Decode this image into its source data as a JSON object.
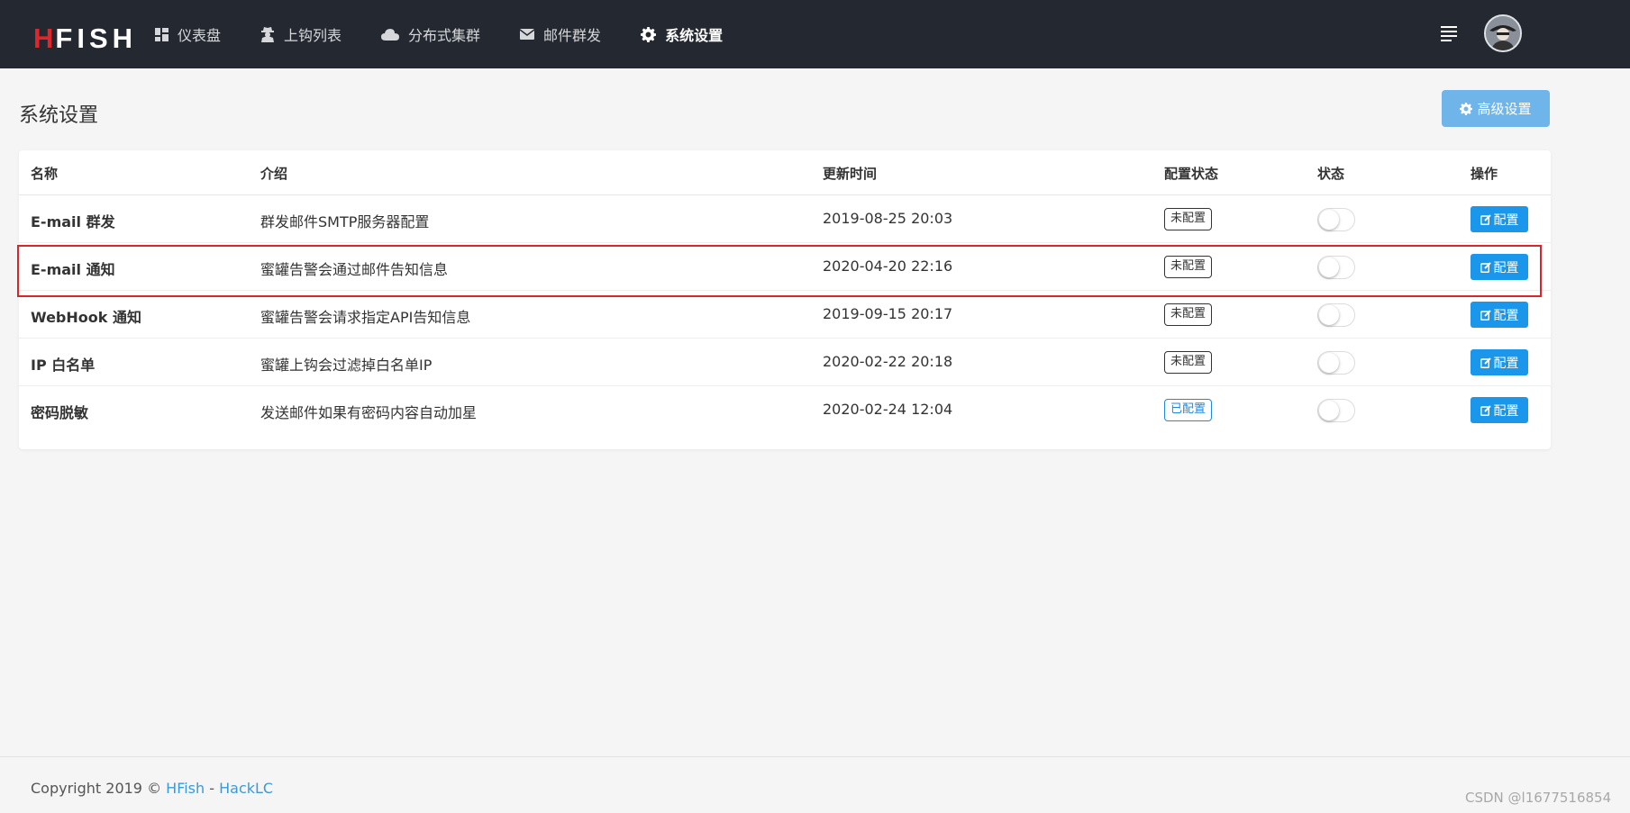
{
  "app": {
    "logo_h": "H",
    "logo_rest": "FISH"
  },
  "nav": {
    "items": [
      {
        "label": "仪表盘",
        "icon": "dashboard-icon"
      },
      {
        "label": "上钩列表",
        "icon": "user-secret-icon"
      },
      {
        "label": "分布式集群",
        "icon": "cloud-icon"
      },
      {
        "label": "邮件群发",
        "icon": "envelope-icon"
      },
      {
        "label": "系统设置",
        "icon": "gear-icon",
        "active": true
      }
    ]
  },
  "header": {
    "menu_icon": "list-icon",
    "avatar_icon": "avatar"
  },
  "page": {
    "title": "系统设置",
    "advanced_button": "高级设置"
  },
  "table": {
    "columns": [
      "名称",
      "介绍",
      "更新时间",
      "配置状态",
      "状态",
      "操作"
    ],
    "rows": [
      {
        "name": "E-mail 群发",
        "desc": "群发邮件SMTP服务器配置",
        "updated": "2019-08-25 20:03",
        "config_status": "未配置",
        "configured": false,
        "enabled": false,
        "action": "配置"
      },
      {
        "name": "E-mail 通知",
        "desc": "蜜罐告警会通过邮件告知信息",
        "updated": "2020-04-20 22:16",
        "config_status": "未配置",
        "configured": false,
        "enabled": false,
        "action": "配置"
      },
      {
        "name": "WebHook 通知",
        "desc": "蜜罐告警会请求指定API告知信息",
        "updated": "2019-09-15 20:17",
        "config_status": "未配置",
        "configured": false,
        "enabled": false,
        "action": "配置"
      },
      {
        "name": "IP 白名单",
        "desc": "蜜罐上钩会过滤掉白名单IP",
        "updated": "2020-02-22 20:18",
        "config_status": "未配置",
        "configured": false,
        "enabled": false,
        "action": "配置"
      },
      {
        "name": "密码脱敏",
        "desc": "发送邮件如果有密码内容自动加星",
        "updated": "2020-02-24 12:04",
        "config_status": "已配置",
        "configured": true,
        "enabled": false,
        "action": "配置"
      }
    ]
  },
  "footer": {
    "copyright": "Copyright 2019 © ",
    "link1": "HFish",
    "sep": " - ",
    "link2": "HackLC"
  },
  "watermark": "CSDN @l1677516854",
  "colors": {
    "topbar": "#242830",
    "accent": "#1a96ea",
    "logo_red": "#e0262b",
    "highlight": "#d9262b"
  }
}
